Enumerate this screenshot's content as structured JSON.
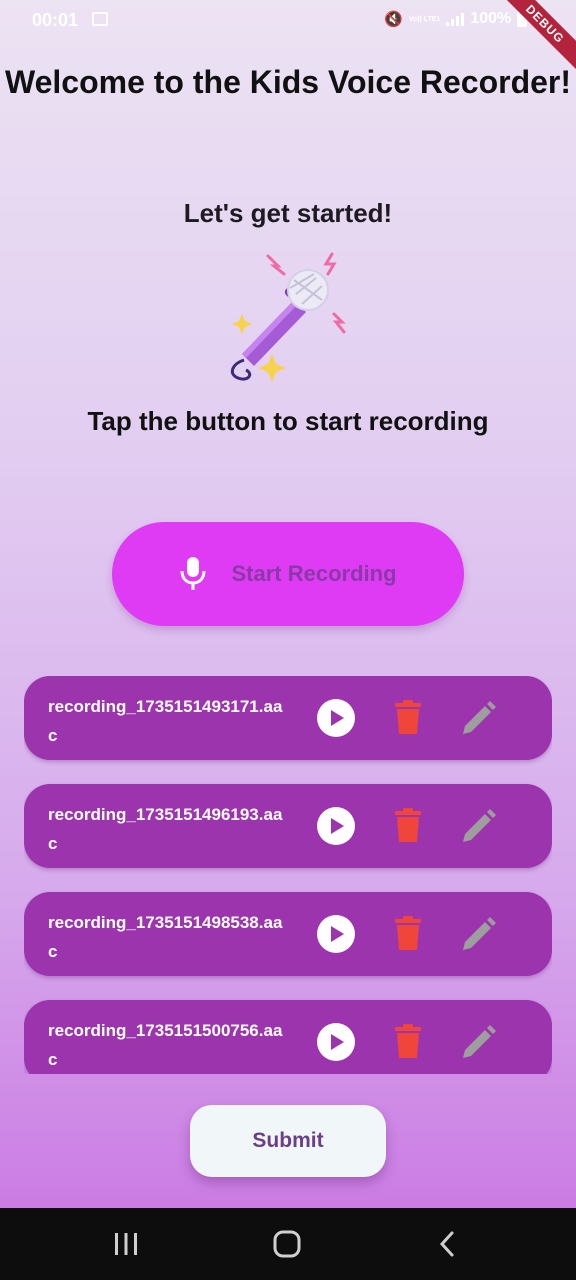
{
  "status_bar": {
    "time": "00:01",
    "network_label": "Vo)) LTE1",
    "battery": "100%"
  },
  "debug_banner": "DEBUG",
  "header": {
    "title": "Welcome to the Kids Voice Recorder!",
    "subtitle": "Let's get started!",
    "instruction": "Tap the button to start recording"
  },
  "record_button": {
    "label": "Start Recording"
  },
  "recordings": [
    {
      "filename": "recording_1735151493171.aac"
    },
    {
      "filename": "recording_1735151496193.aac"
    },
    {
      "filename": "recording_1735151498538.aac"
    },
    {
      "filename": "recording_1735151500756.aac"
    }
  ],
  "submit_button": {
    "label": "Submit"
  },
  "icons": {
    "play": "play-icon",
    "delete": "trash-icon",
    "edit": "pencil-icon",
    "mic": "mic-icon"
  },
  "colors": {
    "record_button": "#df3bf4",
    "card": "#9c34ad",
    "delete": "#f0453b",
    "edit": "#9e9e9e"
  }
}
